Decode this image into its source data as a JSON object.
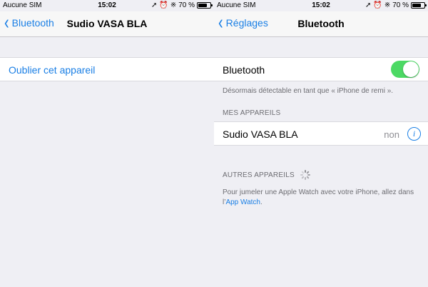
{
  "status_bar": {
    "carrier": "Aucune SIM",
    "time": "15:02",
    "battery_text": "70 %",
    "battery_level": 0.7,
    "icons": [
      "location-arrow-icon",
      "alarm-icon",
      "bluetooth-icon",
      "battery-icon"
    ]
  },
  "left_screen": {
    "nav": {
      "back_label": "Bluetooth",
      "title": "Sudio VASA BLA"
    },
    "forget_label": "Oublier cet appareil"
  },
  "right_screen": {
    "nav": {
      "back_label": "Réglages",
      "title": "Bluetooth"
    },
    "bluetooth_label": "Bluetooth",
    "bluetooth_on": true,
    "discoverable_text": "Désormais détectable en tant que « iPhone de remi ».",
    "my_devices_header": "MES APPAREILS",
    "devices": [
      {
        "name": "Sudio VASA BLA",
        "status": "non"
      }
    ],
    "other_devices_header": "AUTRES APPAREILS",
    "watch_text_before": "Pour jumeler une Apple Watch avec votre iPhone, allez dans l’",
    "watch_link": "App Watch",
    "watch_text_after": "."
  },
  "colors": {
    "accent": "#1a7fe5",
    "toggle_on": "#4cd964",
    "background": "#efeff4",
    "secondary_text": "#6d6d72"
  }
}
